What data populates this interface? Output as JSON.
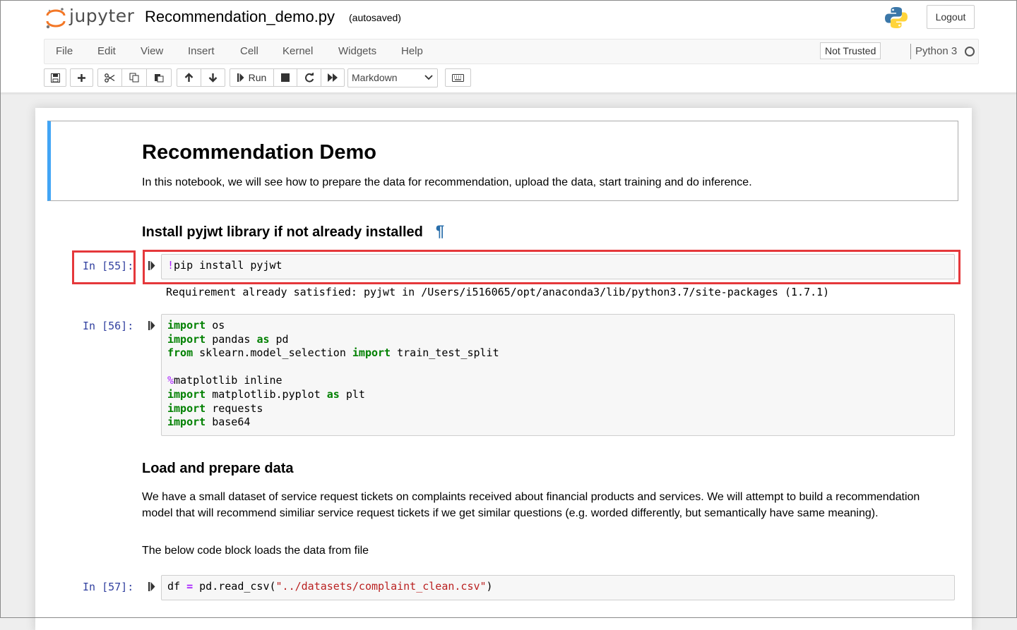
{
  "header": {
    "logo_text": "jupyter",
    "notebook_name": "Recommendation_demo.py",
    "autosave_status": "(autosaved)",
    "logout_label": "Logout"
  },
  "menubar": {
    "items": [
      "File",
      "Edit",
      "View",
      "Insert",
      "Cell",
      "Kernel",
      "Widgets",
      "Help"
    ],
    "trust_status": "Not Trusted",
    "kernel_name": "Python 3"
  },
  "toolbar": {
    "run_label": "Run",
    "cell_type": "Markdown",
    "buttons": [
      "save-icon",
      "plus-icon",
      "scissors-icon",
      "copy-icon",
      "paste-icon",
      "arrow-up-icon",
      "arrow-down-icon",
      "run-icon",
      "stop-icon",
      "restart-icon",
      "fast-forward-icon",
      "keyboard-icon"
    ]
  },
  "notebook": {
    "intro_title": "Recommendation Demo",
    "intro_text": "In this notebook, we will see how to prepare the data for recommendation, upload the data, start training and do inference.",
    "section1_heading": "Install pyjwt library if not already installed",
    "anchor_symbol": "¶",
    "cell55": {
      "prompt": "In [55]:",
      "bang": "!",
      "code": "pip install pyjwt",
      "output": "Requirement already satisfied: pyjwt in /Users/i516065/opt/anaconda3/lib/python3.7/site-packages (1.7.1)"
    },
    "cell56": {
      "prompt": "In [56]:",
      "l1_kw": "import",
      "l1_rest": " os",
      "l2_kw": "import",
      "l2_mid": " pandas ",
      "l2_kw2": "as",
      "l2_rest": " pd",
      "l3_kw": "from",
      "l3_mid": " sklearn.model_selection ",
      "l3_kw2": "import",
      "l3_rest": " train_test_split",
      "l5_mag": "%",
      "l5_rest": "matplotlib inline",
      "l6_kw": "import",
      "l6_mid": " matplotlib.pyplot ",
      "l6_kw2": "as",
      "l6_rest": " plt",
      "l7_kw": "import",
      "l7_rest": " requests",
      "l8_kw": "import",
      "l8_rest": " base64"
    },
    "section2_heading": "Load and prepare data",
    "section2_text": "We have a small dataset of service request tickets on complaints received about financial products and services. We will attempt to build a recommendation model that will recommend similiar service request tickets if we get similar questions (e.g. worded differently, but semantically have same meaning).",
    "section2_text2": "The below code block loads the data from file",
    "cell57": {
      "prompt": "In [57]:",
      "var": "df ",
      "op": "=",
      "call": " pd.read_csv(",
      "str": "\"../datasets/complaint_clean.csv\"",
      "close": ")"
    }
  },
  "colors": {
    "selected_border": "#42a5f5",
    "highlight": "#e5383b",
    "prompt": "#303f9f",
    "keyword": "#008000",
    "magic": "#aa22ff",
    "string": "#ba2121"
  }
}
